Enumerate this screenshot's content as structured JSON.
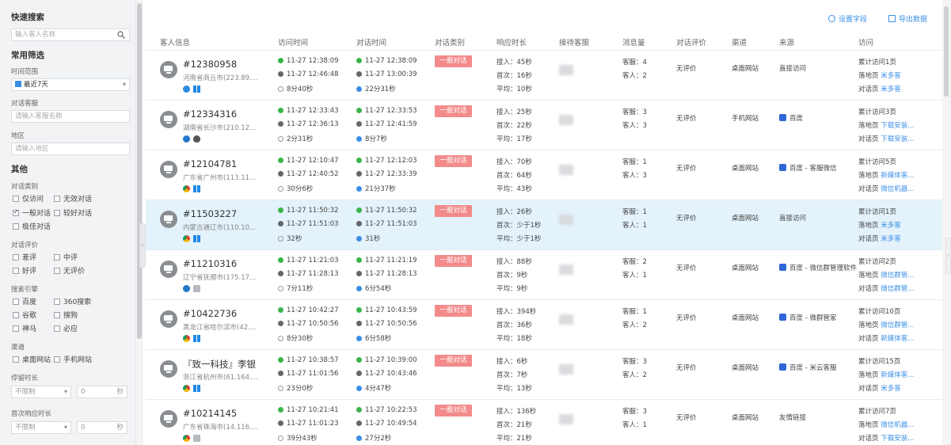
{
  "sidebar": {
    "quick_search_title": "快速搜索",
    "search_placeholder": "输入客人名称",
    "common_filter_title": "常用筛选",
    "time_range_label": "时间范围",
    "time_range_value": "最近7天",
    "agent_label": "对话客服",
    "agent_placeholder": "请输入客服名称",
    "region_label": "地区",
    "region_placeholder": "请输入地区",
    "other_title": "其他",
    "conv_type_label": "对话类别",
    "conv_types": [
      {
        "label": "仅访问",
        "checked": false
      },
      {
        "label": "无效对话",
        "checked": false
      },
      {
        "label": "一般对话",
        "checked": true
      },
      {
        "label": "较好对话",
        "checked": false
      },
      {
        "label": "极佳对话",
        "checked": false
      }
    ],
    "rating_label": "对话评价",
    "ratings": [
      {
        "label": "差评",
        "checked": false
      },
      {
        "label": "中评",
        "checked": false
      },
      {
        "label": "好评",
        "checked": false
      },
      {
        "label": "无评价",
        "checked": false
      }
    ],
    "engine_label": "搜索引擎",
    "engines": [
      {
        "label": "百度",
        "checked": false
      },
      {
        "label": "360搜索",
        "checked": false
      },
      {
        "label": "谷歌",
        "checked": false
      },
      {
        "label": "搜狗",
        "checked": false
      },
      {
        "label": "神马",
        "checked": false
      },
      {
        "label": "必应",
        "checked": false
      }
    ],
    "channel_label": "渠道",
    "channels": [
      {
        "label": "桌面网站",
        "checked": false
      },
      {
        "label": "手机网站",
        "checked": false
      }
    ],
    "stay_label": "停留时长",
    "stay_select": "不限制",
    "stay_value": "0",
    "stay_unit": "秒",
    "first_resp_label": "首次响应时长",
    "first_resp_select": "不限制",
    "first_resp_value": "0",
    "first_resp_unit": "秒"
  },
  "toolbar": {
    "settings_label": "设置字段",
    "export_label": "导出数据"
  },
  "columns": [
    "客人信息",
    "访问时间",
    "对话时间",
    "对话类别",
    "响应时长",
    "接待客服",
    "消息量",
    "对话评价",
    "渠道",
    "来源",
    "访问"
  ],
  "rows": [
    {
      "id": "#12380958",
      "loc": "河南省商丘市(223.89....",
      "icons": [
        "ie",
        "win"
      ],
      "visit_start": "11-27 12:38:09",
      "visit_end": "11-27 12:46:48",
      "visit_dur": "8分40秒",
      "chat_start": "11-27 12:38:09",
      "chat_end": "11-27 13:00:39",
      "chat_dur": "22分31秒",
      "type": "一般对话",
      "resp1": "接入：45秒",
      "resp2": "首次：16秒",
      "resp3": "平均：10秒",
      "msg1": "客服：4",
      "msg2": "客人：2",
      "rating": "无评价",
      "channel": "桌面网站",
      "source": "直接访问",
      "source_icon": false,
      "v1": "累计访问1页",
      "v2_label": "落地页",
      "v2_link": "米多客",
      "v3_label": "对话页",
      "v3_link": "米多客",
      "highlight": false
    },
    {
      "id": "#12334316",
      "loc": "湖南省长沙市(210.12...",
      "icons": [
        "blue",
        "apple"
      ],
      "visit_start": "11-27 12:33:43",
      "visit_end": "11-27 12:36:13",
      "visit_dur": "2分31秒",
      "chat_start": "11-27 12:33:53",
      "chat_end": "11-27 12:41:59",
      "chat_dur": "8分7秒",
      "type": "一般对话",
      "resp1": "接入：25秒",
      "resp2": "首次：22秒",
      "resp3": "平均：17秒",
      "msg1": "客服：3",
      "msg2": "客人：3",
      "rating": "无评价",
      "channel": "手机网站",
      "source": "百度",
      "source_icon": true,
      "v1": "累计访问3页",
      "v2_label": "落地页",
      "v2_link": "下载安装...",
      "v3_label": "对话页",
      "v3_link": "下载安装...",
      "highlight": false
    },
    {
      "id": "#12104781",
      "loc": "广东省广州市(113.11...",
      "icons": [
        "chrome",
        "win"
      ],
      "visit_start": "11-27 12:10:47",
      "visit_end": "11-27 12:40:52",
      "visit_dur": "30分6秒",
      "chat_start": "11-27 12:12:03",
      "chat_end": "11-27 12:33:39",
      "chat_dur": "21分37秒",
      "type": "一般对话",
      "resp1": "接入：70秒",
      "resp2": "首次：64秒",
      "resp3": "平均：43秒",
      "msg1": "客服：1",
      "msg2": "客人：3",
      "rating": "无评价",
      "channel": "桌面网站",
      "source": "百度 - 客服微信",
      "source_icon": true,
      "v1": "累计访问5页",
      "v2_label": "落地页",
      "v2_link": "新媒体客...",
      "v3_label": "对话页",
      "v3_link": "微信机器...",
      "highlight": false
    },
    {
      "id": "#11503227",
      "loc": "内蒙古通辽市(110.10...",
      "icons": [
        "chrome",
        "win"
      ],
      "visit_start": "11-27 11:50:32",
      "visit_end": "11-27 11:51:03",
      "visit_dur": "32秒",
      "chat_start": "11-27 11:50:32",
      "chat_end": "11-27 11:51:03",
      "chat_dur": "31秒",
      "type": "一般对话",
      "resp1": "接入：26秒",
      "resp2": "首次：少于1秒",
      "resp3": "平均：少于1秒",
      "msg1": "客服：1",
      "msg2": "客人：1",
      "rating": "无评价",
      "channel": "桌面网站",
      "source": "直接访问",
      "source_icon": false,
      "v1": "累计访问1页",
      "v2_label": "落地页",
      "v2_link": "米多客",
      "v3_label": "对话页",
      "v3_link": "米多客",
      "highlight": true
    },
    {
      "id": "#11210316",
      "loc": "辽宁省抚顺市(175.17...",
      "icons": [
        "blue",
        "doc"
      ],
      "visit_start": "11-27 11:21:03",
      "visit_end": "11-27 11:28:13",
      "visit_dur": "7分11秒",
      "chat_start": "11-27 11:21:19",
      "chat_end": "11-27 11:28:13",
      "chat_dur": "6分54秒",
      "type": "一般对话",
      "resp1": "接入：88秒",
      "resp2": "首次：9秒",
      "resp3": "平均：9秒",
      "msg1": "客服：2",
      "msg2": "客人：1",
      "rating": "无评价",
      "channel": "桌面网站",
      "source": "百度 - 微信群管理软件",
      "source_icon": true,
      "v1": "累计访问2页",
      "v2_label": "落地页",
      "v2_link": "微信群管...",
      "v3_label": "对话页",
      "v3_link": "微信群管...",
      "highlight": false
    },
    {
      "id": "#10422736",
      "loc": "黑龙江省哈尔滨市(42....",
      "icons": [
        "chrome",
        "win"
      ],
      "visit_start": "11-27 10:42:27",
      "visit_end": "11-27 10:50:56",
      "visit_dur": "8分30秒",
      "chat_start": "11-27 10:43:59",
      "chat_end": "11-27 10:50:56",
      "chat_dur": "6分58秒",
      "type": "一般对话",
      "resp1": "接入：394秒",
      "resp2": "首次：36秒",
      "resp3": "平均：18秒",
      "msg1": "客服：1",
      "msg2": "客人：2",
      "rating": "无评价",
      "channel": "桌面网站",
      "source": "百度 - 微群管家",
      "source_icon": true,
      "v1": "累计访问10页",
      "v2_label": "落地页",
      "v2_link": "微信群管...",
      "v3_label": "对话页",
      "v3_link": "新媒体客...",
      "highlight": false
    },
    {
      "id": "『致一科技』李银",
      "loc": "浙江省杭州市(61.164....",
      "icons": [
        "chrome",
        "win"
      ],
      "visit_start": "11-27 10:38:57",
      "visit_end": "11-27 11:01:56",
      "visit_dur": "23分0秒",
      "chat_start": "11-27 10:39:00",
      "chat_end": "11-27 10:43:46",
      "chat_dur": "4分47秒",
      "type": "一般对话",
      "resp1": "接入：6秒",
      "resp2": "首次：7秒",
      "resp3": "平均：13秒",
      "msg1": "客服：3",
      "msg2": "客人：2",
      "rating": "无评价",
      "channel": "桌面网站",
      "source": "百度 - 米云客服",
      "source_icon": true,
      "v1": "累计访问15页",
      "v2_label": "落地页",
      "v2_link": "新媒体客...",
      "v3_label": "对话页",
      "v3_link": "米多客",
      "highlight": false
    },
    {
      "id": "#10214145",
      "loc": "广东省珠海市(14.116....",
      "icons": [
        "chrome",
        "doc"
      ],
      "visit_start": "11-27 10:21:41",
      "visit_end": "11-27 11:01:23",
      "visit_dur": "39分43秒",
      "chat_start": "11-27 10:22:53",
      "chat_end": "11-27 10:49:54",
      "chat_dur": "27分2秒",
      "type": "一般对话",
      "resp1": "接入：136秒",
      "resp2": "首次：21秒",
      "resp3": "平均：21秒",
      "msg1": "客服：3",
      "msg2": "客人：1",
      "rating": "无评价",
      "channel": "桌面网站",
      "source": "友情链接",
      "source_icon": false,
      "v1": "累计访问7页",
      "v2_label": "落地页",
      "v2_link": "微信机器...",
      "v3_label": "对话页",
      "v3_link": "下载安装...",
      "highlight": false
    }
  ]
}
